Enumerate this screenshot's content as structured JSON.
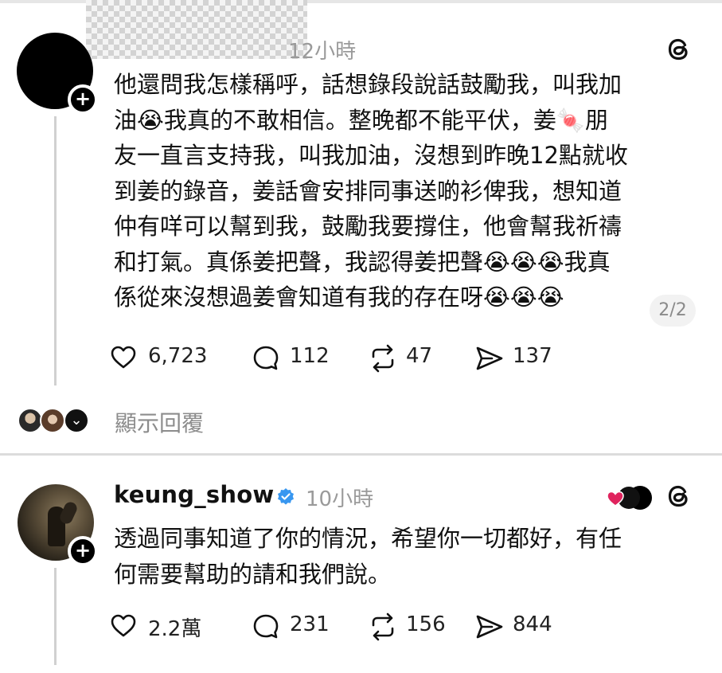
{
  "post1": {
    "time": "12小時",
    "body": "他還問我怎樣稱呼，話想錄段說話鼓勵我，叫我加\n油😭我真的不敢相信。整晚都不能平伏，姜🍬朋\n友一直言支持我，叫我加油，沒想到昨晚12點就收\n到姜的錄音，姜話會安排同事送啲衫俾我，想知道\n仲有咩可以幫到我，鼓勵我要撐住，他會幫我祈禱\n和打氣。真係姜把聲，我認得姜把聲😭😭😭我真\n係從來沒想過姜會知道有我的存在呀😭😭😭",
    "page_indicator": "2/2",
    "likes": "6,723",
    "replies": "112",
    "reposts": "47",
    "shares": "137",
    "show_replies": "顯示回覆"
  },
  "post2": {
    "username": "keung_show",
    "time": "10小時",
    "body": "透過同事知道了你的情況，希望你一切都好，有任\n何需要幫助的請和我們說。",
    "likes": "2.2萬",
    "replies": "231",
    "reposts": "156",
    "shares": "844"
  },
  "icons": {
    "follow": "plus-icon",
    "app": "threads-logo-icon",
    "like": "heart-icon",
    "reply": "comment-icon",
    "repost": "repost-icon",
    "share": "send-icon",
    "verified": "verified-badge-icon"
  },
  "colors": {
    "verified": "#3897f0",
    "heart_badge": "#e0245e",
    "muted_text": "#9a9a9a"
  }
}
